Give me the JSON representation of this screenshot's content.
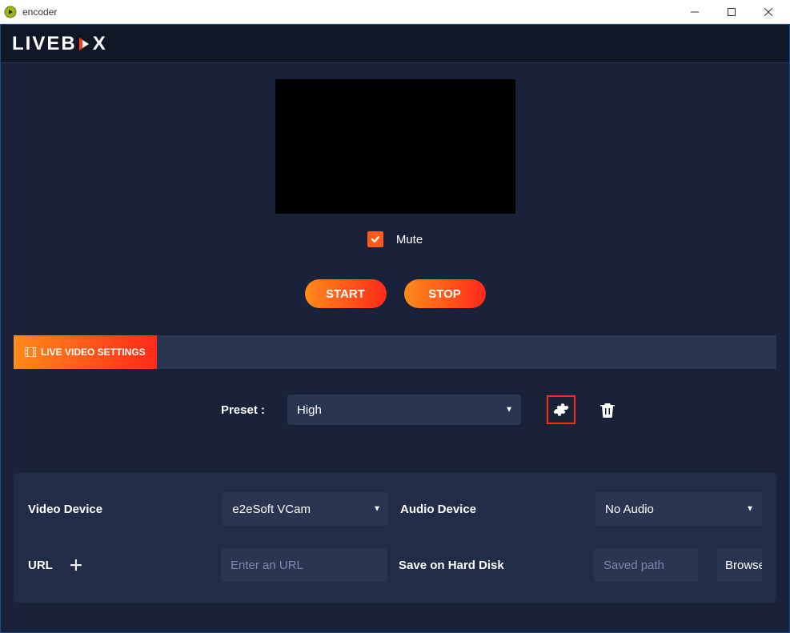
{
  "window": {
    "title": "encoder"
  },
  "brand": {
    "part1": "LIVEB",
    "part2": "X"
  },
  "preview": {
    "mute_label": "Mute",
    "mute_checked": true
  },
  "actions": {
    "start": "START",
    "stop": "STOP"
  },
  "tab": {
    "label": "LIVE VIDEO SETTINGS"
  },
  "preset": {
    "label": "Preset :",
    "value": "High"
  },
  "devices": {
    "video_label": "Video Device",
    "video_value": "e2eSoft VCam",
    "audio_label": "Audio Device",
    "audio_value": "No Audio",
    "url_label": "URL",
    "url_placeholder": "Enter an URL",
    "url_value": "",
    "save_label": "Save on Hard Disk",
    "save_placeholder": "Saved path",
    "save_value": "",
    "browse": "Browse"
  }
}
